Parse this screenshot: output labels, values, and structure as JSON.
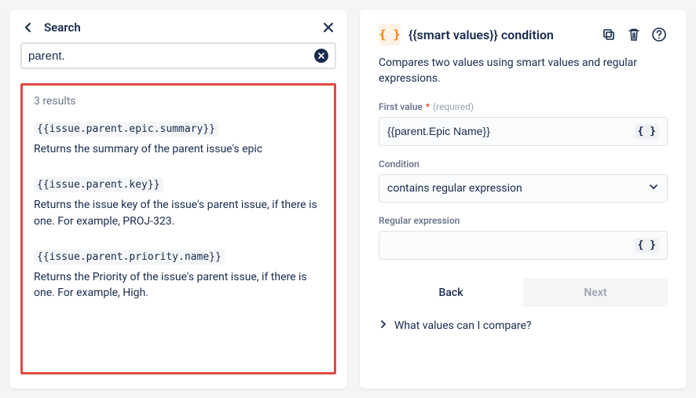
{
  "search": {
    "title": "Search",
    "input_value": "parent.",
    "results_count_label": "3 results",
    "results": [
      {
        "code": "{{issue.parent.epic.summary}}",
        "desc": "Returns the summary of the parent issue's epic"
      },
      {
        "code": "{{issue.parent.key}}",
        "desc": "Returns the issue key of the issue's parent issue, if there is one. For example, PROJ-323."
      },
      {
        "code": "{{issue.parent.priority.name}}",
        "desc": "Returns the Priority of the issue's parent issue, if there is one. For example, High."
      }
    ]
  },
  "condition": {
    "icon": "{ }",
    "title": "{{smart values}} condition",
    "description": "Compares two values using smart values and regular expressions.",
    "first_value": {
      "label": "First value",
      "required_marker": "*",
      "required_text": "(required)",
      "value": "{{parent.Epic Name}}"
    },
    "condition_field": {
      "label": "Condition",
      "selected": "contains regular expression"
    },
    "regex": {
      "label": "Regular expression",
      "value": "        "
    },
    "back_label": "Back",
    "next_label": "Next",
    "expand_label": "What values can I compare?"
  }
}
